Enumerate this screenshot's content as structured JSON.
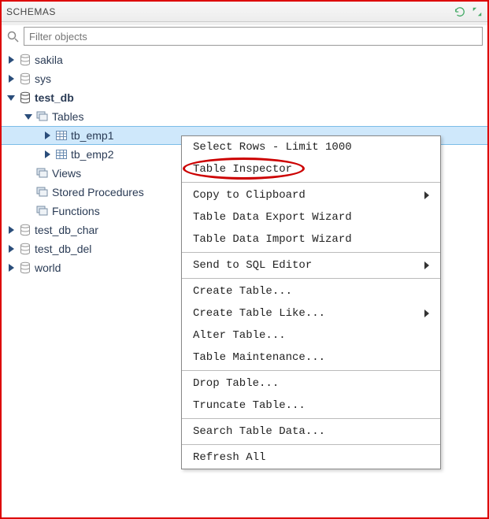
{
  "header": {
    "title": "SCHEMAS"
  },
  "search": {
    "placeholder": "Filter objects"
  },
  "tree": {
    "items": [
      {
        "label": "sakila",
        "type": "schema"
      },
      {
        "label": "sys",
        "type": "schema"
      },
      {
        "label": "test_db",
        "type": "schema",
        "expanded": true,
        "bold": true
      },
      {
        "label": "Tables",
        "type": "folder",
        "expanded": true
      },
      {
        "label": "tb_emp1",
        "type": "table",
        "selected": true
      },
      {
        "label": "tb_emp2",
        "type": "table"
      },
      {
        "label": "Views",
        "type": "folder-views"
      },
      {
        "label": "Stored Procedures",
        "type": "folder-sp"
      },
      {
        "label": "Functions",
        "type": "folder-fn"
      },
      {
        "label": "test_db_char",
        "type": "schema"
      },
      {
        "label": "test_db_del",
        "type": "schema"
      },
      {
        "label": "world",
        "type": "schema"
      }
    ]
  },
  "contextMenu": {
    "items": [
      {
        "label": "Select Rows - Limit 1000"
      },
      {
        "label": "Table Inspector",
        "highlighted": true
      },
      {
        "sep": true
      },
      {
        "label": "Copy to Clipboard",
        "submenu": true
      },
      {
        "label": "Table Data Export Wizard"
      },
      {
        "label": "Table Data Import Wizard"
      },
      {
        "sep": true
      },
      {
        "label": "Send to SQL Editor",
        "submenu": true
      },
      {
        "sep": true
      },
      {
        "label": "Create Table..."
      },
      {
        "label": "Create Table Like...",
        "submenu": true
      },
      {
        "label": "Alter Table..."
      },
      {
        "label": "Table Maintenance..."
      },
      {
        "sep": true
      },
      {
        "label": "Drop Table..."
      },
      {
        "label": "Truncate Table..."
      },
      {
        "sep": true
      },
      {
        "label": "Search Table Data..."
      },
      {
        "sep": true
      },
      {
        "label": "Refresh All"
      }
    ]
  }
}
